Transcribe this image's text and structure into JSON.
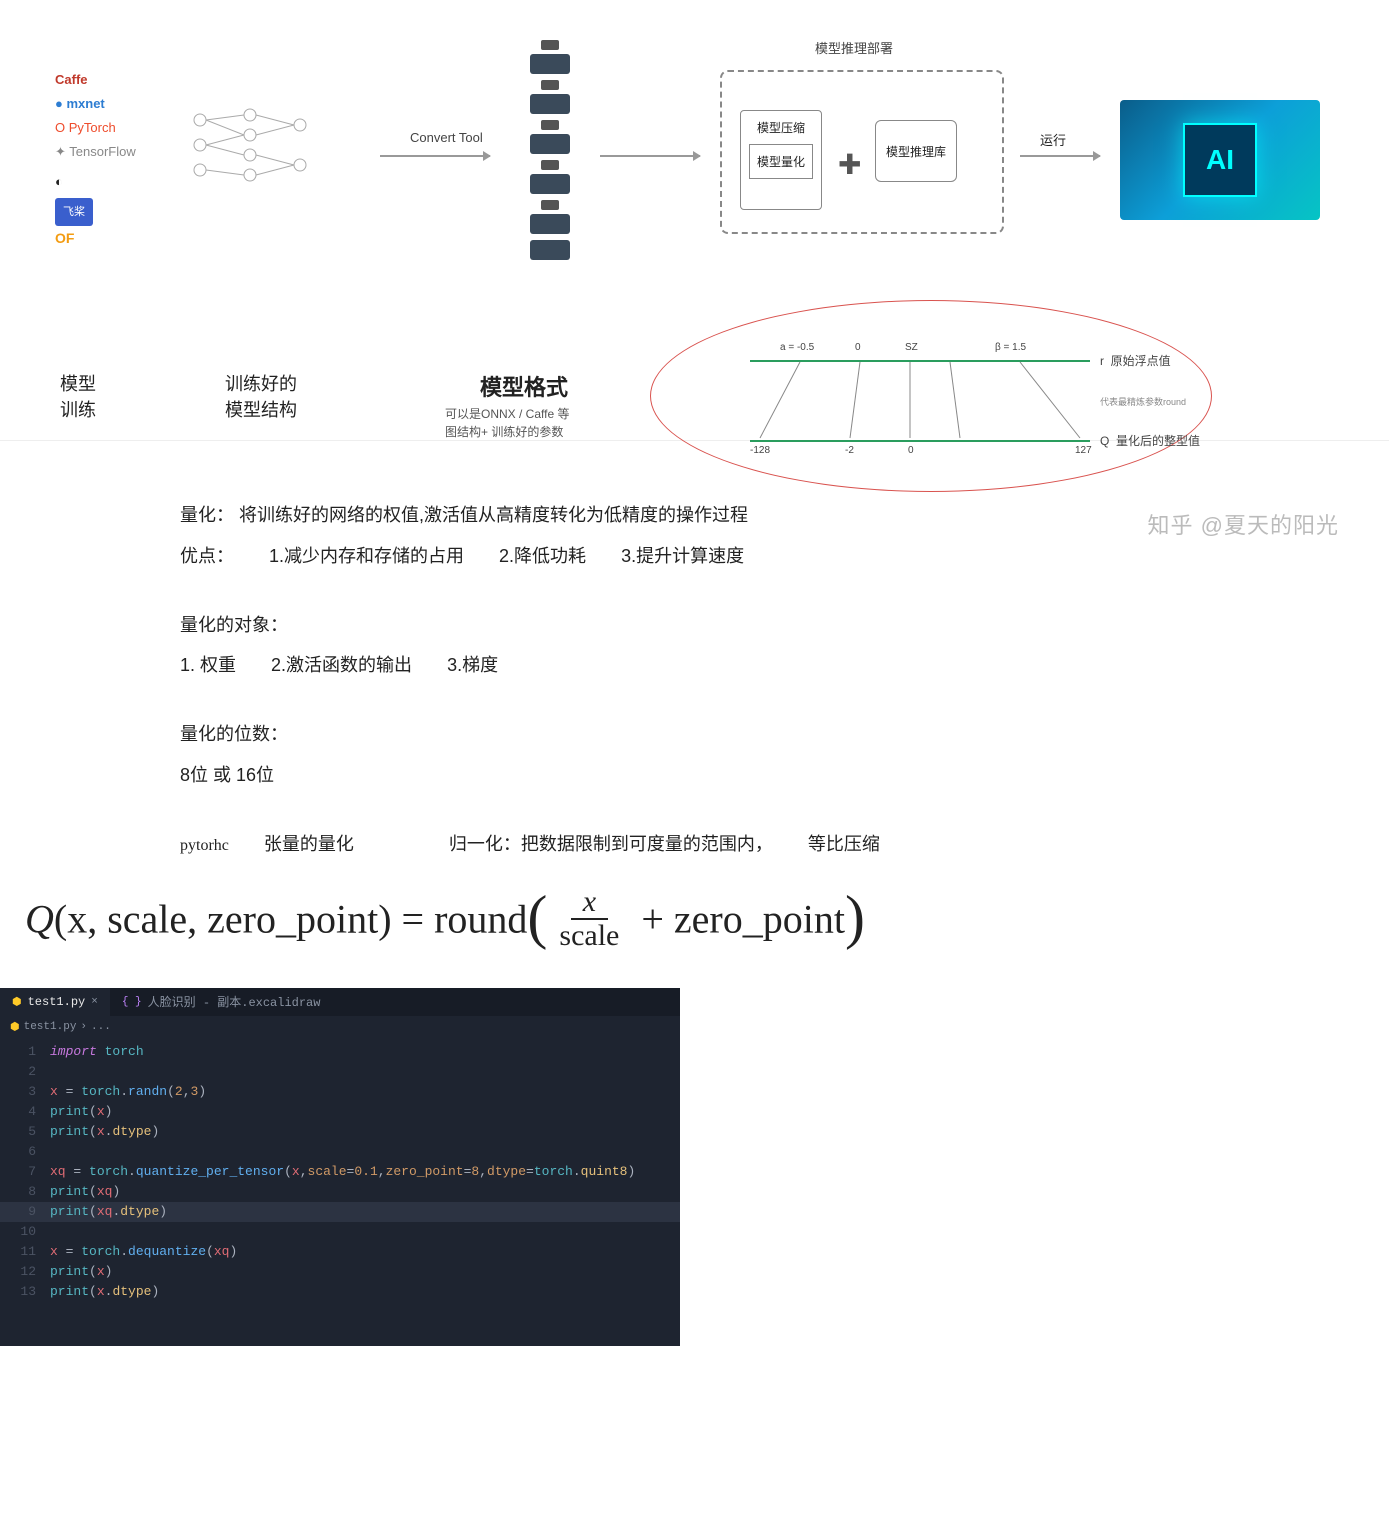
{
  "diagram": {
    "frameworks": {
      "caffe": "Caffe",
      "mxnet": "mxnet",
      "pytorch": "PyTorch",
      "tensorflow": "TensorFlow",
      "paddle": "飞桨",
      "oneflow": "OF"
    },
    "convert_tool": "Convert Tool",
    "deploy_title": "模型推理部署",
    "compress_title": "模型压缩",
    "compress_inner": "模型量化",
    "infer_lib": "模型推理库",
    "run": "运行",
    "chip": "AI",
    "labels": {
      "train": "模型\n训练",
      "struct": "训练好的\n模型结构",
      "format": "模型格式",
      "format_sub1": "可以是ONNX / Caffe 等",
      "format_sub2": "图结构+ 训练好的参数"
    },
    "quant_vis": {
      "a_label": "a = -0.5",
      "zero": "0",
      "sz": "SZ",
      "b_label": "β = 1.5",
      "r": "r",
      "orig": "原始浮点值",
      "round_note": "代表最精炼参数round",
      "q": "Q",
      "quant": "量化后的整型值",
      "n128": "-128",
      "n2": "-2",
      "zero2": "0",
      "p127": "127"
    },
    "watermark": "知乎 @夏天的阳光"
  },
  "notes": {
    "quantize_label": "量化：",
    "quantize_def": "将训练好的网络的权值,激活值从高精度转化为低精度的操作过程",
    "adv_label": "优点：",
    "adv1": "1.减少内存和存储的占用",
    "adv2": "2.降低功耗",
    "adv3": "3.提升计算速度",
    "target_label": "量化的对象：",
    "t1": "1. 权重",
    "t2": "2.激活函数的输出",
    "t3": "3.梯度",
    "bits_label": "量化的位数：",
    "bits_val": "8位 或 16位",
    "pytorch_lbl": "pytorhc",
    "tensor_q": "张量的量化",
    "norm_label": "归一化：",
    "norm_def1": "把数据限制到可度量的范围内，",
    "norm_def2": "等比压缩"
  },
  "formula": {
    "Q": "Q",
    "args": "(x, scale, zero_point) = round",
    "num": "x",
    "den": "scale",
    "plus": " + zero_point"
  },
  "editor": {
    "tab1": "test1.py",
    "tab2": "人脸识别 - 副本.excalidraw",
    "crumb_file": "test1.py",
    "crumb_sep": "›",
    "crumb_tail": "...",
    "lines": [
      {
        "n": "1",
        "segs": [
          {
            "c": "tok-kw",
            "t": "import"
          },
          {
            "c": "tok-pn",
            "t": " "
          },
          {
            "c": "tok-mod",
            "t": "torch"
          }
        ]
      },
      {
        "n": "2",
        "segs": []
      },
      {
        "n": "3",
        "segs": [
          {
            "c": "tok-var",
            "t": "x"
          },
          {
            "c": "tok-op",
            "t": " = "
          },
          {
            "c": "tok-mod",
            "t": "torch"
          },
          {
            "c": "tok-pn",
            "t": "."
          },
          {
            "c": "tok-fn",
            "t": "randn"
          },
          {
            "c": "tok-pn",
            "t": "("
          },
          {
            "c": "tok-num",
            "t": "2"
          },
          {
            "c": "tok-pn",
            "t": ","
          },
          {
            "c": "tok-num",
            "t": "3"
          },
          {
            "c": "tok-pn",
            "t": ")"
          }
        ]
      },
      {
        "n": "4",
        "segs": [
          {
            "c": "tok-builtin",
            "t": "print"
          },
          {
            "c": "tok-pn",
            "t": "("
          },
          {
            "c": "tok-var",
            "t": "x"
          },
          {
            "c": "tok-pn",
            "t": ")"
          }
        ]
      },
      {
        "n": "5",
        "segs": [
          {
            "c": "tok-builtin",
            "t": "print"
          },
          {
            "c": "tok-pn",
            "t": "("
          },
          {
            "c": "tok-var",
            "t": "x"
          },
          {
            "c": "tok-pn",
            "t": "."
          },
          {
            "c": "tok-attr",
            "t": "dtype"
          },
          {
            "c": "tok-pn",
            "t": ")"
          }
        ]
      },
      {
        "n": "6",
        "segs": []
      },
      {
        "n": "7",
        "segs": [
          {
            "c": "tok-var",
            "t": "xq"
          },
          {
            "c": "tok-op",
            "t": " = "
          },
          {
            "c": "tok-mod",
            "t": "torch"
          },
          {
            "c": "tok-pn",
            "t": "."
          },
          {
            "c": "tok-fn",
            "t": "quantize_per_tensor"
          },
          {
            "c": "tok-pn",
            "t": "("
          },
          {
            "c": "tok-var",
            "t": "x"
          },
          {
            "c": "tok-pn",
            "t": ","
          },
          {
            "c": "tok-param",
            "t": "scale"
          },
          {
            "c": "tok-op",
            "t": "="
          },
          {
            "c": "tok-num",
            "t": "0.1"
          },
          {
            "c": "tok-pn",
            "t": ","
          },
          {
            "c": "tok-param",
            "t": "zero_point"
          },
          {
            "c": "tok-op",
            "t": "="
          },
          {
            "c": "tok-num",
            "t": "8"
          },
          {
            "c": "tok-pn",
            "t": ","
          },
          {
            "c": "tok-param",
            "t": "dtype"
          },
          {
            "c": "tok-op",
            "t": "="
          },
          {
            "c": "tok-mod",
            "t": "torch"
          },
          {
            "c": "tok-pn",
            "t": "."
          },
          {
            "c": "tok-attr",
            "t": "quint8"
          },
          {
            "c": "tok-pn",
            "t": ")"
          }
        ]
      },
      {
        "n": "8",
        "segs": [
          {
            "c": "tok-builtin",
            "t": "print"
          },
          {
            "c": "tok-pn",
            "t": "("
          },
          {
            "c": "tok-var",
            "t": "xq"
          },
          {
            "c": "tok-pn",
            "t": ")"
          }
        ]
      },
      {
        "n": "9",
        "hl": true,
        "segs": [
          {
            "c": "tok-builtin",
            "t": "print"
          },
          {
            "c": "tok-pn",
            "t": "("
          },
          {
            "c": "tok-var",
            "t": "xq"
          },
          {
            "c": "tok-pn",
            "t": "."
          },
          {
            "c": "tok-attr",
            "t": "dtype"
          },
          {
            "c": "tok-pn",
            "t": ")"
          }
        ]
      },
      {
        "n": "10",
        "segs": []
      },
      {
        "n": "11",
        "segs": [
          {
            "c": "tok-var",
            "t": "x"
          },
          {
            "c": "tok-op",
            "t": " = "
          },
          {
            "c": "tok-mod",
            "t": "torch"
          },
          {
            "c": "tok-pn",
            "t": "."
          },
          {
            "c": "tok-fn",
            "t": "dequantize"
          },
          {
            "c": "tok-pn",
            "t": "("
          },
          {
            "c": "tok-var",
            "t": "xq"
          },
          {
            "c": "tok-pn",
            "t": ")"
          }
        ]
      },
      {
        "n": "12",
        "segs": [
          {
            "c": "tok-builtin",
            "t": "print"
          },
          {
            "c": "tok-pn",
            "t": "("
          },
          {
            "c": "tok-var",
            "t": "x"
          },
          {
            "c": "tok-pn",
            "t": ")"
          }
        ]
      },
      {
        "n": "13",
        "segs": [
          {
            "c": "tok-builtin",
            "t": "print"
          },
          {
            "c": "tok-pn",
            "t": "("
          },
          {
            "c": "tok-var",
            "t": "x"
          },
          {
            "c": "tok-pn",
            "t": "."
          },
          {
            "c": "tok-attr",
            "t": "dtype"
          },
          {
            "c": "tok-pn",
            "t": ")"
          }
        ]
      }
    ]
  }
}
